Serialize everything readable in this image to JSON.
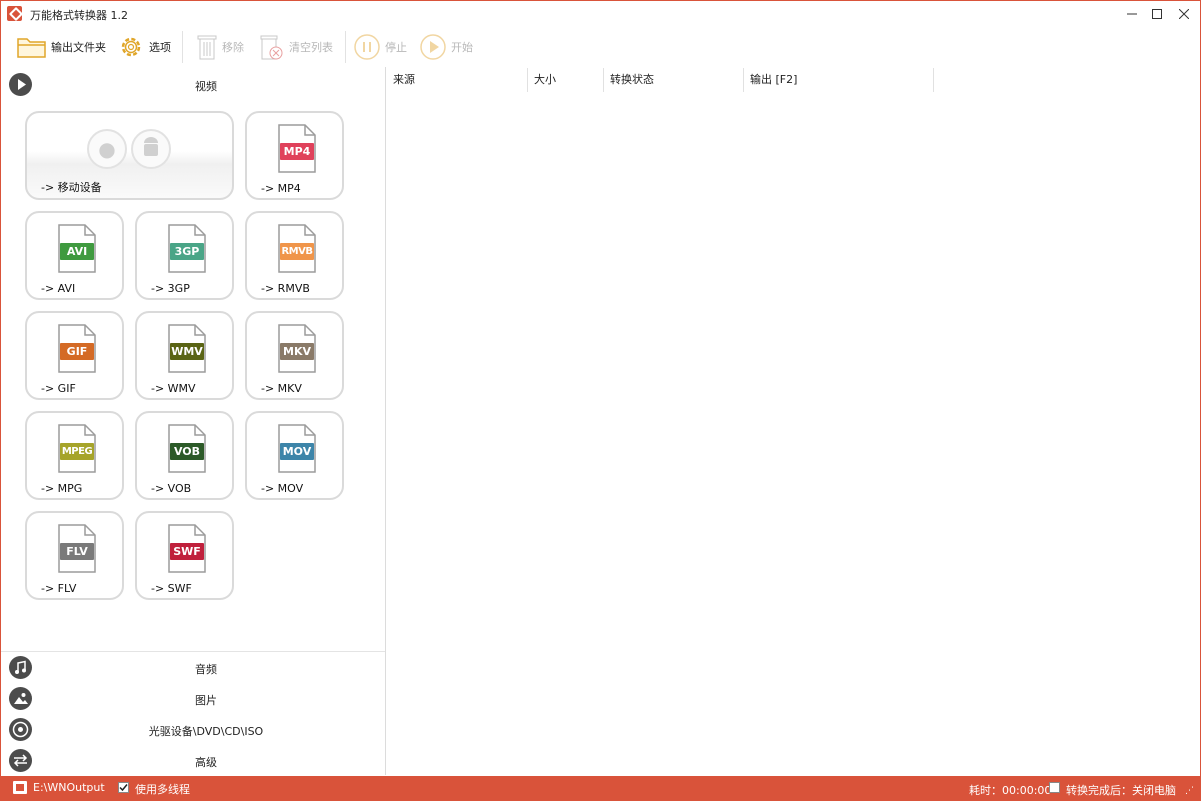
{
  "window": {
    "title": "万能格式转换器 1.2"
  },
  "toolbar": {
    "output_folder": "输出文件夹",
    "options": "选项",
    "remove": "移除",
    "clear_list": "清空列表",
    "stop": "停止",
    "start": "开始"
  },
  "categories": {
    "video": "视频",
    "audio": "音频",
    "image": "图片",
    "disc": "光驱设备\\DVD\\CD\\ISO",
    "advanced": "高级"
  },
  "formats": [
    {
      "label": "-> 移动设备"
    },
    {
      "label": "-> MP4",
      "badge": "MP4",
      "color": "#e0415b"
    },
    {
      "label": "-> AVI",
      "badge": "AVI",
      "color": "#3f9a3f"
    },
    {
      "label": "-> 3GP",
      "badge": "3GP",
      "color": "#4aa587"
    },
    {
      "label": "-> RMVB",
      "badge": "RMVB",
      "color": "#f0954a"
    },
    {
      "label": "-> GIF",
      "badge": "GIF",
      "color": "#d46a25"
    },
    {
      "label": "-> WMV",
      "badge": "WMV",
      "color": "#5a6414"
    },
    {
      "label": "-> MKV",
      "badge": "MKV",
      "color": "#8a7a68"
    },
    {
      "label": "-> MPG",
      "badge": "MPEG",
      "color": "#a6a42a"
    },
    {
      "label": "-> VOB",
      "badge": "VOB",
      "color": "#2c5a28"
    },
    {
      "label": "-> MOV",
      "badge": "MOV",
      "color": "#3d85a9"
    },
    {
      "label": "-> FLV",
      "badge": "FLV",
      "color": "#7a7a7a"
    },
    {
      "label": "-> SWF",
      "badge": "SWF",
      "color": "#c0203c"
    }
  ],
  "list_columns": {
    "source": "来源",
    "size": "大小",
    "status": "转换状态",
    "output": "输出 [F2]"
  },
  "statusbar": {
    "output_path": "E:\\WNOutput",
    "multithread": "使用多线程",
    "elapsed": "耗时：00:00:00",
    "after_done": "转换完成后：关闭电脑"
  },
  "colors": {
    "accent": "#d9533a"
  }
}
